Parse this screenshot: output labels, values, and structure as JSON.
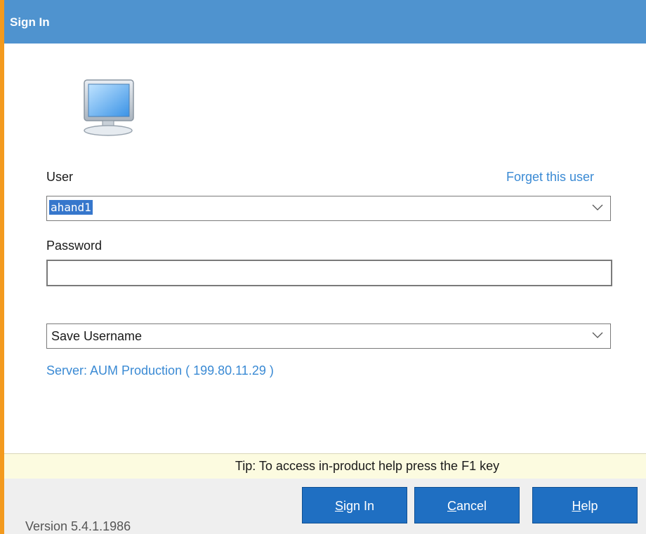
{
  "window": {
    "title": "Sign In"
  },
  "user": {
    "label": "User",
    "forget_link": "Forget this user",
    "value": "ahand1"
  },
  "password": {
    "label": "Password",
    "value": ""
  },
  "save_option": {
    "selected": "Save Username"
  },
  "server_info": "Server: AUM Production ( 199.80.11.29 )",
  "tip": "Tip: To access in-product help press the F1 key",
  "version": "Version 5.4.1.1986",
  "buttons": {
    "sign_in": {
      "first": "S",
      "rest": "ign In"
    },
    "cancel": {
      "first": "C",
      "rest": "ancel"
    },
    "help": {
      "first": "H",
      "rest": "elp"
    }
  },
  "colors": {
    "titlebar": "#4f93cf",
    "accent_left": "#f39a1e",
    "link": "#3a8ad4",
    "button": "#1f6fc2",
    "tip_bg": "#fcfbe0"
  },
  "icons": [
    "monitor-icon",
    "chevron-down-icon"
  ]
}
